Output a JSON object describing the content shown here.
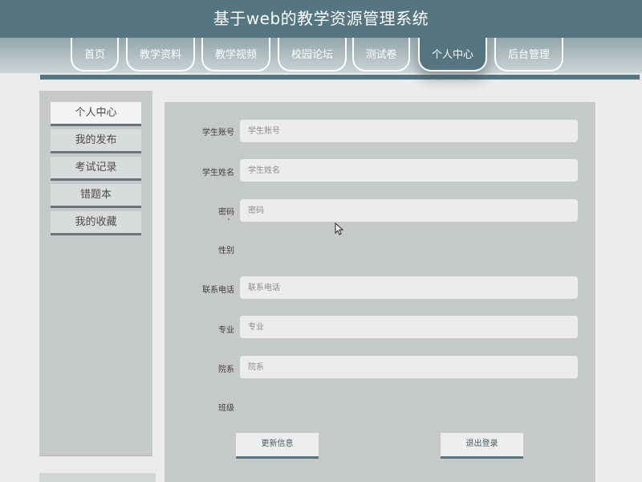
{
  "header": {
    "title": "基于web的教学资源管理系统"
  },
  "nav": {
    "tabs": [
      {
        "label": "首页",
        "active": false
      },
      {
        "label": "教学资料",
        "active": false
      },
      {
        "label": "教学视频",
        "active": false
      },
      {
        "label": "校园论坛",
        "active": false
      },
      {
        "label": "测试卷",
        "active": false
      },
      {
        "label": "个人中心",
        "active": true
      },
      {
        "label": "后台管理",
        "active": false
      }
    ]
  },
  "sidebar": {
    "items": [
      {
        "label": "个人中心",
        "active": true
      },
      {
        "label": "我的发布",
        "active": false
      },
      {
        "label": "考试记录",
        "active": false
      },
      {
        "label": "错题本",
        "active": false
      },
      {
        "label": "我的收藏",
        "active": false
      }
    ]
  },
  "form": {
    "fields": [
      {
        "label": "学生账号",
        "placeholder": "学生账号",
        "value": ""
      },
      {
        "label": "学生姓名",
        "placeholder": "学生姓名",
        "value": ""
      },
      {
        "label": "密码",
        "placeholder": "密码",
        "value": ""
      },
      {
        "label": "性别"
      },
      {
        "label": "联系电话",
        "placeholder": "联系电话",
        "value": ""
      },
      {
        "label": "专业",
        "placeholder": "专业",
        "value": ""
      },
      {
        "label": "院系",
        "placeholder": "院系",
        "value": ""
      },
      {
        "label": "班级"
      }
    ],
    "update_label": "更新信息",
    "logout_label": "退出登录"
  },
  "colors": {
    "header_bg": "#557680",
    "accent": "#557680",
    "panel_bg": "#c6c9ca",
    "page_bg": "#ececec"
  }
}
